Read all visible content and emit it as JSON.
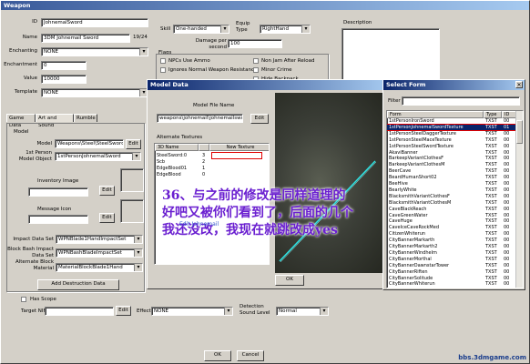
{
  "weapon_window": {
    "title": "Weapon",
    "id_label": "ID",
    "id_value": "JohnemalSword",
    "name_label": "Name",
    "name_value": "3DM Johnemail Sword",
    "name_counter": "19/24",
    "enchanting_label": "Enchanting",
    "enchanting_value": "NONE",
    "enchantment_label": "Enchantment",
    "enchantment_value": "0",
    "value_label": "Value",
    "value_value": "10000",
    "template_label": "Template",
    "template_value": "NONE",
    "skill_label": "Skill",
    "skill_value": "One-handed",
    "equip_type_label": "Equip Type",
    "equip_type_value": "RightHand",
    "damage_label": "Damage per second",
    "damage_value": "100",
    "description_label": "Description",
    "flags_label": "Flags",
    "flags": [
      "NPCs Use Ammo",
      "Non Jam After Reload",
      "Ignores Normal Weapon Resistance",
      "Minor Crime",
      "Hide Backpack"
    ],
    "tabs": [
      "Game Data",
      "Art and Sound",
      "Rumble"
    ],
    "model_group": "Model",
    "model_label": "Model",
    "model_value": "Weapons\\Steel\\SteelSword.nif",
    "edit": "Edit",
    "first_person_label": "1st Person Model Object",
    "first_person_value": "1stPersonJohnemalSword",
    "inventory_image_label": "Inventory Image",
    "message_icon_label": "Message Icon",
    "impact_label": "Impact Data Set",
    "impact_value": "WPNBlade1HandImpactSet",
    "block_bash_label": "Block Bash Impact Data Set",
    "block_bash_value": "WPNBashBladeImpactSet",
    "alt_block_label": "Alternate Block Material",
    "alt_block_value": "MaterialBlockBlade1Hand",
    "add_destruction": "Add Destruction Data",
    "has_scope": "Has Scope",
    "target_nif_label": "Target NIF",
    "effect_label": "Effect",
    "effect_value": "NONE",
    "detection_label": "Detection Sound Level",
    "detection_value": "Normal",
    "ok": "OK",
    "cancel": "Cancel"
  },
  "model_dialog": {
    "title": "Model Data",
    "file_name_label": "Model File Name",
    "file_name_value": "weapons\\johnemail\\johnemailsword.nif",
    "edit": "Edit",
    "alt_textures_label": "Alternate Textures",
    "columns": [
      "3D Name",
      "",
      "New Texture"
    ],
    "rows": [
      {
        "name": "SteelSword:0",
        "idx": "3",
        "tex": ""
      },
      {
        "name": "Scb",
        "idx": "2",
        "tex": ""
      },
      {
        "name": "EdgeBlood01",
        "idx": "1",
        "tex": ""
      },
      {
        "name": "EdgeBlood",
        "idx": "0",
        "tex": ""
      }
    ],
    "ok": "OK",
    "overlay_small": "Edit Johnemail"
  },
  "select_form": {
    "title": "Select Form",
    "filter_label": "Filter",
    "columns": [
      "Form",
      "Type",
      "ID"
    ],
    "rows": [
      {
        "form": "1stPersonIronSword",
        "type": "TXST",
        "id": "00"
      },
      {
        "form": "1stPersonJohnemalSwordTexture",
        "type": "TXST",
        "id": "01"
      },
      {
        "form": "1stPersonSteelDaggerTexture",
        "type": "TXST",
        "id": "00"
      },
      {
        "form": "1stPersonSteelMaceTexture",
        "type": "TXST",
        "id": "00"
      },
      {
        "form": "1stPersonSteelSwordTexture",
        "type": "TXST",
        "id": "00"
      },
      {
        "form": "AkaviBanner",
        "type": "TXST",
        "id": "00"
      },
      {
        "form": "BarkeepVariantClothesF",
        "type": "TXST",
        "id": "00"
      },
      {
        "form": "BarkeepVariantClothesM",
        "type": "TXST",
        "id": "00"
      },
      {
        "form": "BeerCave",
        "type": "TXST",
        "id": "00"
      },
      {
        "form": "BeardHumanShort02",
        "type": "TXST",
        "id": "00"
      },
      {
        "form": "BeeHive",
        "type": "TXST",
        "id": "00"
      },
      {
        "form": "BearlyWhite",
        "type": "TXST",
        "id": "00"
      },
      {
        "form": "BlacksmithVariantClothesF",
        "type": "TXST",
        "id": "00"
      },
      {
        "form": "BlacksmithVariantClothesM",
        "type": "TXST",
        "id": "00"
      },
      {
        "form": "CaveBlackReach",
        "type": "TXST",
        "id": "00"
      },
      {
        "form": "CaveGreenWater",
        "type": "TXST",
        "id": "00"
      },
      {
        "form": "CaveHuge",
        "type": "TXST",
        "id": "00"
      },
      {
        "form": "CaveIceCaveRockMed",
        "type": "TXST",
        "id": "00"
      },
      {
        "form": "CitizenWhiterun",
        "type": "TXST",
        "id": "00"
      },
      {
        "form": "CityBannerMarkarth",
        "type": "TXST",
        "id": "00"
      },
      {
        "form": "CityBannerMarkarth2",
        "type": "TXST",
        "id": "00"
      },
      {
        "form": "CityBannerWindhelm",
        "type": "TXST",
        "id": "00"
      },
      {
        "form": "CityBannerMorthal",
        "type": "TXST",
        "id": "00"
      },
      {
        "form": "CityBannerDawnstarTower",
        "type": "TXST",
        "id": "00"
      },
      {
        "form": "CityBannerRiften",
        "type": "TXST",
        "id": "00"
      },
      {
        "form": "CityBannerSolitude",
        "type": "TXST",
        "id": "00"
      },
      {
        "form": "CityBannerWhiterun",
        "type": "TXST",
        "id": "00"
      }
    ]
  },
  "overlay": {
    "line1": "36、与之前的修改是同样道理的",
    "line2": "好吧又被你们看到了，后面的几个",
    "line3": "我还没改，我现在就跳改成yes"
  },
  "watermark": "bbs.3dmgame.com",
  "colors": {
    "titlebar": "#0a246a",
    "overlay_text": "#6a1fd0",
    "highlight_red": "#e00000",
    "selection": "#0a246a"
  }
}
